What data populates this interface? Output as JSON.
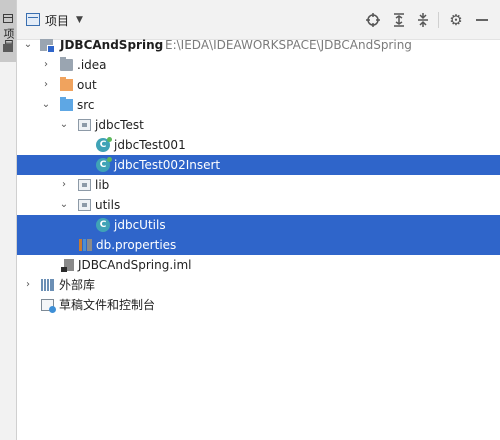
{
  "toolstrip": {
    "tab_label": "项目"
  },
  "header": {
    "title": "项目",
    "buttons": [
      {
        "name": "locate-icon",
        "glyph": "⊕"
      },
      {
        "name": "expand-all-icon",
        "glyph": "⇳"
      },
      {
        "name": "collapse-all-icon",
        "glyph": "⇕"
      },
      {
        "name": "gear-icon",
        "glyph": "⚙"
      },
      {
        "name": "hide-icon",
        "glyph": "—"
      }
    ]
  },
  "tree": {
    "project": {
      "name": "JDBCAndSpring",
      "path": "E:\\IEDA\\IDEAWORKSPACE\\JDBCAndSpring"
    },
    "idea": ".idea",
    "out": "out",
    "src": "src",
    "pkg_jdbcTest": "jdbcTest",
    "class_test001": "jdbcTest001",
    "class_test002": "jdbcTest002Insert",
    "lib": "lib",
    "utils": "utils",
    "class_utils": "jdbcUtils",
    "db_properties": "db.properties",
    "iml": "JDBCAndSpring.iml",
    "external_libs": "外部库",
    "scratches": "草稿文件和控制台"
  },
  "colors": {
    "selection": "#2f65ca",
    "header_bg": "#f2f2f2"
  }
}
